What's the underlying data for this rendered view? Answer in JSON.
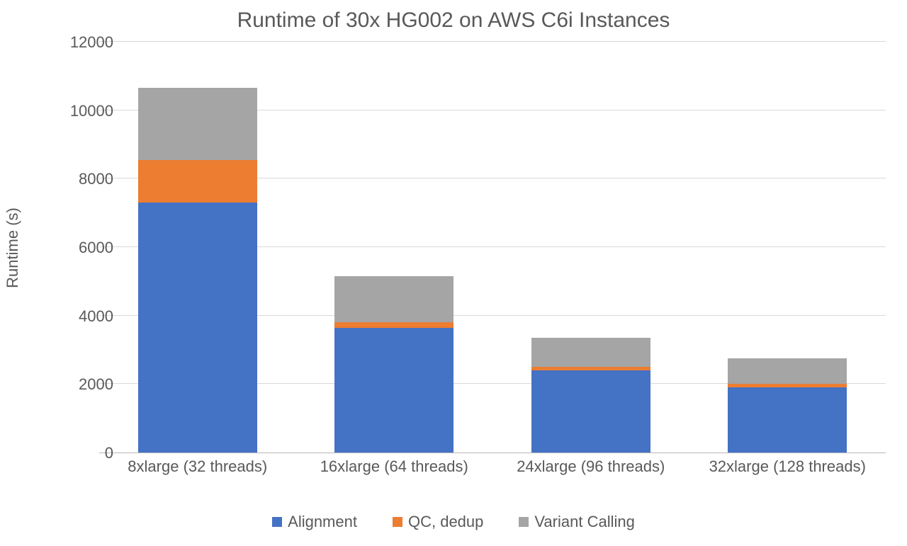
{
  "chart_data": {
    "type": "bar",
    "title": "Runtime of 30x HG002 on AWS C6i Instances",
    "ylabel": "Runtime (s)",
    "ylim": [
      0,
      12000
    ],
    "ytick_step": 2000,
    "categories": [
      "8xlarge (32 threads)",
      "16xlarge (64 threads)",
      "24xlarge (96 threads)",
      "32xlarge (128 threads)"
    ],
    "series": [
      {
        "name": "Alignment",
        "color": "#4472C4",
        "values": [
          7300,
          3650,
          2400,
          1900
        ]
      },
      {
        "name": "QC, dedup",
        "color": "#ED7D31",
        "values": [
          1250,
          150,
          100,
          100
        ]
      },
      {
        "name": "Variant Calling",
        "color": "#A5A5A5",
        "values": [
          2100,
          1350,
          850,
          750
        ]
      }
    ]
  }
}
